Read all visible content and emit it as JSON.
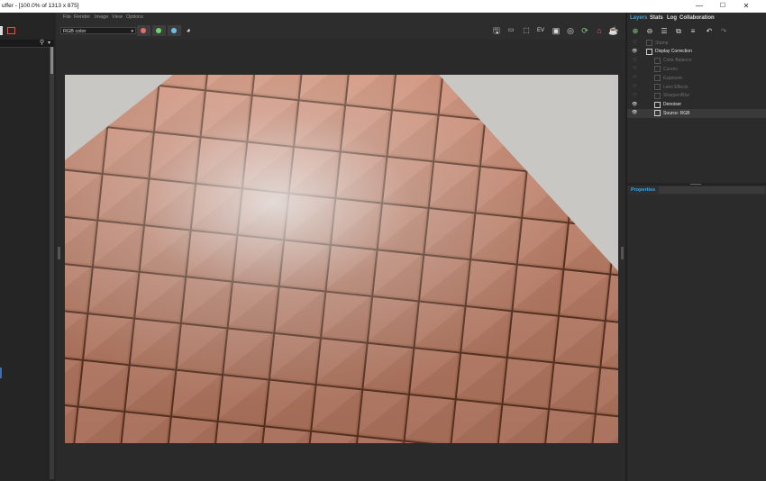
{
  "window": {
    "title": "uffer - [100.0% of 1313 x 875]",
    "controls": [
      "—",
      "☐",
      "✕"
    ]
  },
  "menu": [
    "File",
    "Render",
    "Image",
    "View",
    "Options"
  ],
  "toolbar": {
    "color_mode": "RGB color",
    "channels": [
      {
        "name": "red",
        "color": "#e86a6a"
      },
      {
        "name": "green",
        "color": "#6ad86a"
      },
      {
        "name": "blue",
        "color": "#6ac0e8"
      }
    ]
  },
  "right_panel": {
    "tabs": [
      {
        "label": "Layers",
        "active": true
      },
      {
        "label": "Stats",
        "active": false
      },
      {
        "label": "Log",
        "active": false
      },
      {
        "label": "Collaboration",
        "active": false
      }
    ],
    "layers": [
      {
        "label": "Stamp",
        "visible": false,
        "indent": 1,
        "enabled": false
      },
      {
        "label": "Display Correction",
        "visible": true,
        "indent": 1,
        "enabled": true
      },
      {
        "label": "Color Balance",
        "visible": false,
        "indent": 2,
        "enabled": false
      },
      {
        "label": "Curves",
        "visible": false,
        "indent": 2,
        "enabled": false
      },
      {
        "label": "Exposure",
        "visible": false,
        "indent": 2,
        "enabled": false
      },
      {
        "label": "Lens Effects",
        "visible": false,
        "indent": 2,
        "enabled": false
      },
      {
        "label": "Sharpen/Blur",
        "visible": false,
        "indent": 2,
        "enabled": false
      },
      {
        "label": "Denoiser",
        "visible": true,
        "indent": 2,
        "enabled": true
      },
      {
        "label": "Source: RGB",
        "visible": true,
        "indent": 2,
        "enabled": true
      }
    ],
    "properties_label": "Properties"
  },
  "colors": {
    "accent": "#3ea6e0",
    "background": "#2b2b2b",
    "canvas_bg": "#c9c7c4"
  }
}
